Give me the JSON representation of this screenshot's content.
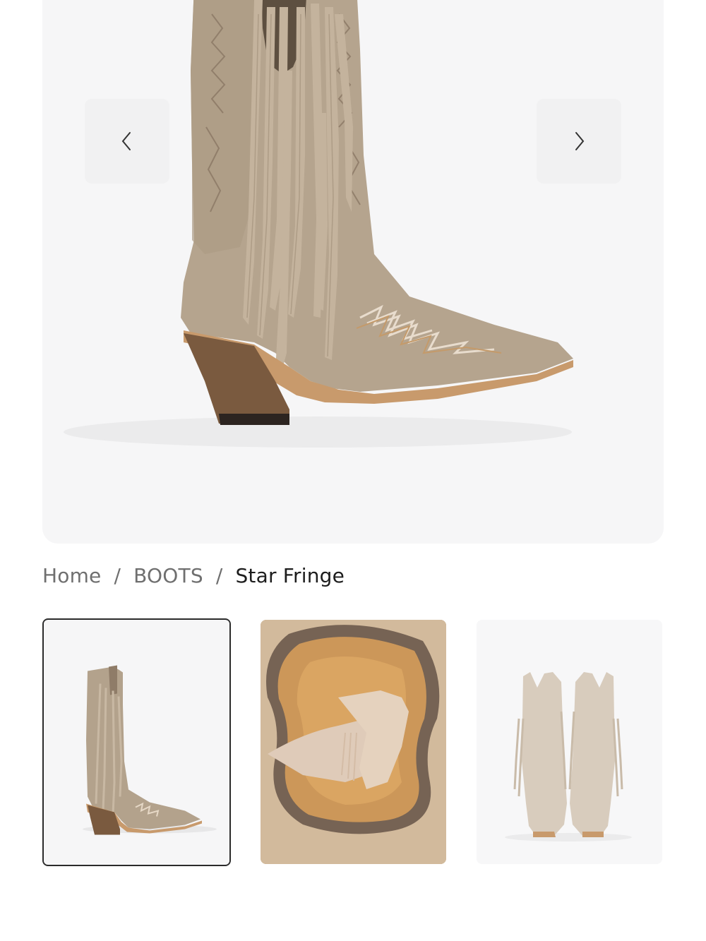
{
  "gallery": {
    "main_image": "star-fringe-boot-side-view",
    "prev_icon": "chevron-left-icon",
    "next_icon": "chevron-right-icon",
    "active_thumbnail": 1
  },
  "breadcrumb": {
    "home": "Home",
    "separator_1": "/",
    "category": "BOOTS",
    "separator_2": "/",
    "current": "Star Fringe"
  },
  "thumbnails": [
    {
      "image": "boot-side-view"
    },
    {
      "image": "boots-in-guitar-case"
    },
    {
      "image": "boots-pair-front-view"
    }
  ],
  "colors": {
    "boot_suede": "#b7a58f",
    "boot_stitch": "#8a7764",
    "heel": "#7a5a3f",
    "sole": "#c89a6c",
    "background": "#f6f6f7",
    "active_border": "#2b2b2b"
  }
}
